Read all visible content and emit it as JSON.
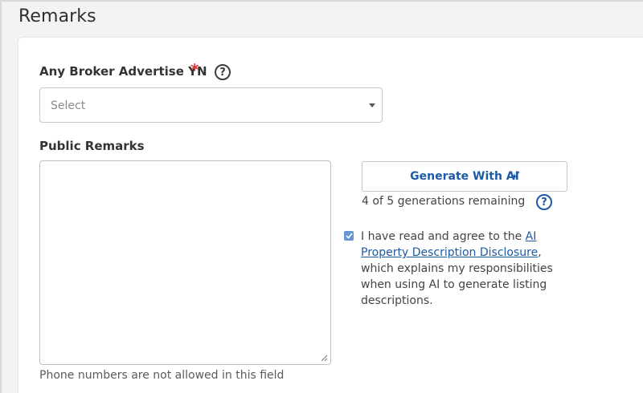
{
  "section": {
    "title": "Remarks"
  },
  "broker_advertise": {
    "label": "Any Broker Advertise YN",
    "required_marker": "*",
    "help_glyph": "?",
    "select": {
      "placeholder": "Select"
    }
  },
  "public_remarks": {
    "label": "Public Remarks",
    "value": "",
    "hint": "Phone numbers are not allowed in this field"
  },
  "ai": {
    "button_label": "Generate With AI",
    "remaining": "4 of 5 generations remaining",
    "help_glyph": "?"
  },
  "disclosure": {
    "checked": true,
    "text_before": "I have read and agree to the ",
    "link_text": "AI Property Description Disclosure",
    "text_after": ", which explains my responsibilities when using AI to generate listing descriptions."
  },
  "colors": {
    "accent": "#1c5aa6",
    "required": "#d9363e",
    "checkbox": "#6a95d4",
    "page_bg": "#f3f3f3"
  },
  "icons": {
    "help": "question-circle-icon",
    "sparkle": "sparkle-icon",
    "caret": "caret-down-icon",
    "check": "check-icon"
  }
}
